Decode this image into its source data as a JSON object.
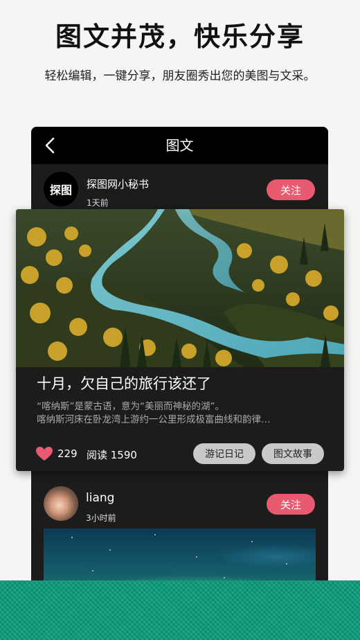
{
  "promo": {
    "title": "图文并茂，快乐分享",
    "subtitle": "轻松编辑，一键分享，朋友圈秀出您的美图与文采。"
  },
  "nav": {
    "title": "图文",
    "back_icon": "chevron-left-icon"
  },
  "post1": {
    "avatar_text": "探图",
    "author": "探图网小秘书",
    "time": "1天前",
    "follow_label": "关注"
  },
  "feature": {
    "title": "十月，欠自己的旅行该还了",
    "desc_line1": "“喀纳斯”是蒙古语，意为“美丽而神秘的湖”。",
    "desc_line2": "喀纳斯河床在卧龙湾上游约一公里形成极富曲线和韵律…",
    "likes": "229",
    "reads": "阅读 1590",
    "tags": [
      "游记日记",
      "图文故事"
    ]
  },
  "post2": {
    "author": "liang",
    "time": "3小时前",
    "follow_label": "关注"
  },
  "colors": {
    "accent": "#e85a70",
    "card_bg": "#1c1c1c",
    "nav_bg": "#000000",
    "tag_bg": "#c9c9c9",
    "band": "#0b9b7a"
  }
}
